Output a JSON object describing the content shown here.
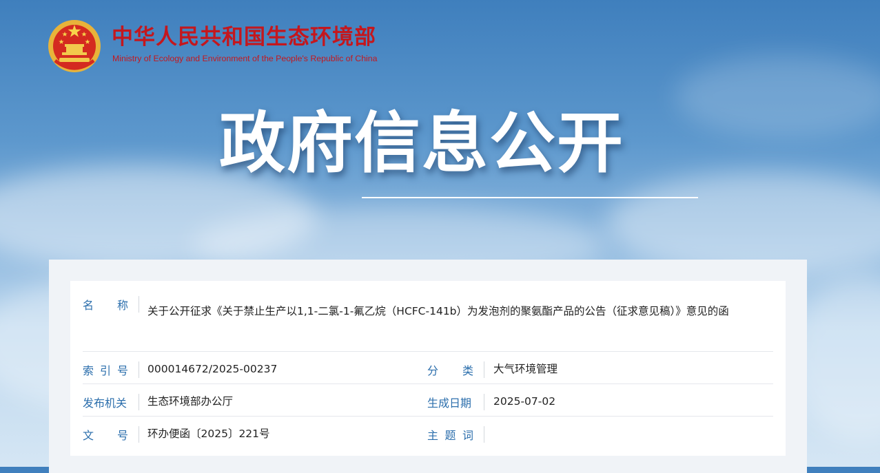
{
  "header": {
    "site_name_cn": "中华人民共和国生态环境部",
    "site_name_en": "Ministry of Ecology and Environment of the People's Republic of China",
    "hero_title": "政府信息公开"
  },
  "colors": {
    "brand_red": "#c4171d",
    "label_blue": "#2b6eac",
    "emblem_gold": "#e8b33a"
  },
  "document": {
    "name": {
      "label": [
        "名",
        "称"
      ],
      "value": "关于公开征求《关于禁止生产以1,1-二氯-1-氟乙烷（HCFC-141b）为发泡剂的聚氨酯产品的公告（征求意见稿）》意见的函"
    },
    "index_no": {
      "label": [
        "索",
        "引",
        "号"
      ],
      "value": "000014672/2025-00237"
    },
    "category": {
      "label": [
        "分",
        "类"
      ],
      "value": "大气环境管理"
    },
    "issuer": {
      "label": [
        "发布机关"
      ],
      "value": "生态环境部办公厅"
    },
    "date": {
      "label": [
        "生成日期"
      ],
      "value": "2025-07-02"
    },
    "doc_no": {
      "label": [
        "文",
        "号"
      ],
      "value": "环办便函〔2025〕221号"
    },
    "keywords": {
      "label": [
        "主",
        "题",
        "词"
      ],
      "value": ""
    }
  }
}
